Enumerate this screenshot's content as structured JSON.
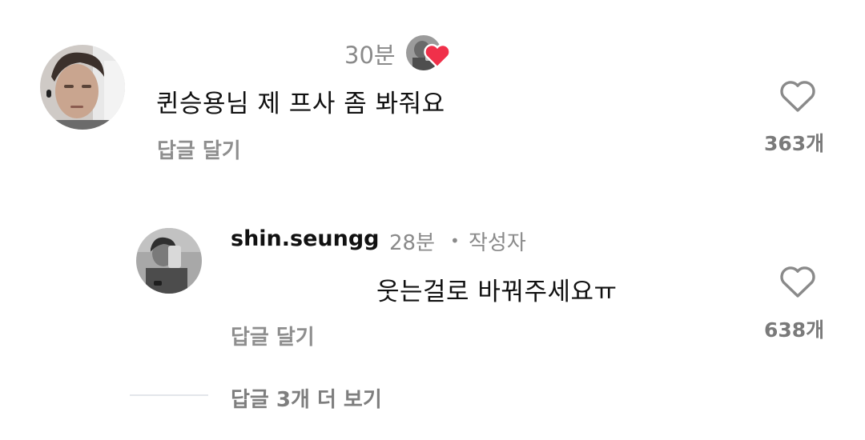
{
  "comment": {
    "time": "30분",
    "text": "퀸승용님 제 프사 좀 봐줘요",
    "reply_label": "답글 달기",
    "like_count": "363개"
  },
  "reply": {
    "username": "shin.seungg",
    "time": "28분",
    "separator": "•",
    "author_tag": "작성자",
    "text": "웃는걸로 바꿔주세요ㅠ",
    "reply_label": "답글 달기",
    "like_count": "638개"
  },
  "view_more": {
    "label": "답글 3개 더 보기"
  },
  "colors": {
    "liked_heart": "#f0304a",
    "meta_gray": "#8a8a8a"
  },
  "icons": [
    "heart-outline-icon",
    "creator-liked-heart-icon"
  ]
}
